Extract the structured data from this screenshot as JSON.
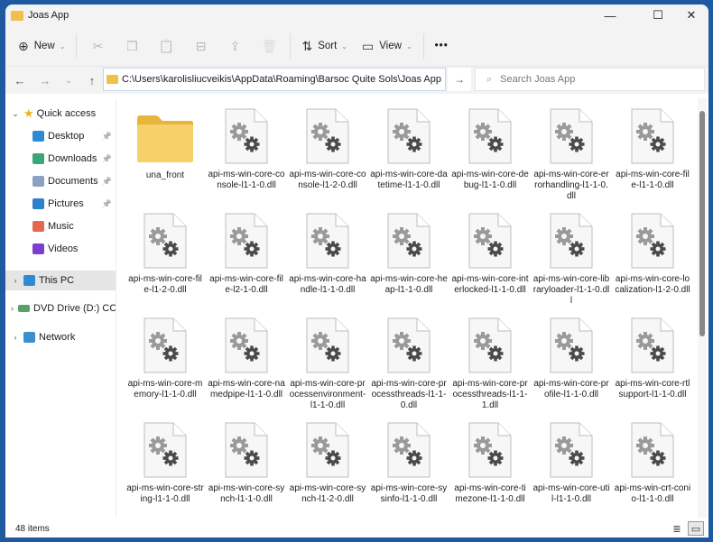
{
  "window": {
    "title": "Joas App",
    "minimize": "—",
    "maximize": "☐",
    "close": "✕"
  },
  "toolbar": {
    "new_label": "New",
    "sort_label": "Sort",
    "view_label": "View",
    "more_label": "•••",
    "icons": {
      "new": "⊕",
      "cut": "✂",
      "copy": "❐",
      "paste": "📋",
      "rename": "⊟",
      "share": "⇪",
      "delete": "🗑",
      "sort": "⇅",
      "view": "▭"
    }
  },
  "nav": {
    "back": "←",
    "forward": "→",
    "recent": "⌄",
    "up": "↑",
    "address": "C:\\Users\\karolisliucveikis\\AppData\\Roaming\\Barsoc Quite Sols\\Joas App",
    "address_dropdown": "⌄",
    "go": "→",
    "search_placeholder": "Search Joas App",
    "search_icon": "⌕"
  },
  "sidebar": {
    "quick_access": "Quick access",
    "items": [
      {
        "label": "Desktop",
        "pinned": true,
        "color": "#2f8ad6"
      },
      {
        "label": "Downloads",
        "pinned": true,
        "color": "#3ca57a"
      },
      {
        "label": "Documents",
        "pinned": true,
        "color": "#8aa2bf"
      },
      {
        "label": "Pictures",
        "pinned": true,
        "color": "#2f7fd0"
      },
      {
        "label": "Music",
        "pinned": false,
        "color": "#e3684f"
      },
      {
        "label": "Videos",
        "pinned": false,
        "color": "#7b3fd0"
      }
    ],
    "this_pc": "This PC",
    "dvd": "DVD Drive (D:) CCCC",
    "network": "Network",
    "pin_glyph": "📌"
  },
  "files": [
    {
      "name": "una_front",
      "type": "folder"
    },
    {
      "name": "api-ms-win-core-console-l1-1-0.dll",
      "type": "dll"
    },
    {
      "name": "api-ms-win-core-console-l1-2-0.dll",
      "type": "dll"
    },
    {
      "name": "api-ms-win-core-datetime-l1-1-0.dll",
      "type": "dll"
    },
    {
      "name": "api-ms-win-core-debug-l1-1-0.dll",
      "type": "dll"
    },
    {
      "name": "api-ms-win-core-errorhandling-l1-1-0.dll",
      "type": "dll"
    },
    {
      "name": "api-ms-win-core-file-l1-1-0.dll",
      "type": "dll"
    },
    {
      "name": "api-ms-win-core-file-l1-2-0.dll",
      "type": "dll"
    },
    {
      "name": "api-ms-win-core-file-l2-1-0.dll",
      "type": "dll"
    },
    {
      "name": "api-ms-win-core-handle-l1-1-0.dll",
      "type": "dll"
    },
    {
      "name": "api-ms-win-core-heap-l1-1-0.dll",
      "type": "dll"
    },
    {
      "name": "api-ms-win-core-interlocked-l1-1-0.dll",
      "type": "dll"
    },
    {
      "name": "api-ms-win-core-libraryloader-l1-1-0.dll",
      "type": "dll"
    },
    {
      "name": "api-ms-win-core-localization-l1-2-0.dll",
      "type": "dll"
    },
    {
      "name": "api-ms-win-core-memory-l1-1-0.dll",
      "type": "dll"
    },
    {
      "name": "api-ms-win-core-namedpipe-l1-1-0.dll",
      "type": "dll"
    },
    {
      "name": "api-ms-win-core-processenvironment-l1-1-0.dll",
      "type": "dll"
    },
    {
      "name": "api-ms-win-core-processthreads-l1-1-0.dll",
      "type": "dll"
    },
    {
      "name": "api-ms-win-core-processthreads-l1-1-1.dll",
      "type": "dll"
    },
    {
      "name": "api-ms-win-core-profile-l1-1-0.dll",
      "type": "dll"
    },
    {
      "name": "api-ms-win-core-rtlsupport-l1-1-0.dll",
      "type": "dll"
    },
    {
      "name": "api-ms-win-core-string-l1-1-0.dll",
      "type": "dll"
    },
    {
      "name": "api-ms-win-core-synch-l1-1-0.dll",
      "type": "dll"
    },
    {
      "name": "api-ms-win-core-synch-l1-2-0.dll",
      "type": "dll"
    },
    {
      "name": "api-ms-win-core-sysinfo-l1-1-0.dll",
      "type": "dll"
    },
    {
      "name": "api-ms-win-core-timezone-l1-1-0.dll",
      "type": "dll"
    },
    {
      "name": "api-ms-win-core-util-l1-1-0.dll",
      "type": "dll"
    },
    {
      "name": "api-ms-win-crt-conio-l1-1-0.dll",
      "type": "dll"
    }
  ],
  "status": {
    "item_count": "48 items",
    "details_view": "≣",
    "tiles_view": "▭"
  },
  "colors": {
    "accent": "#1f5aa0",
    "folder": "#f2c04a",
    "chrome": "#f3f3f3"
  }
}
